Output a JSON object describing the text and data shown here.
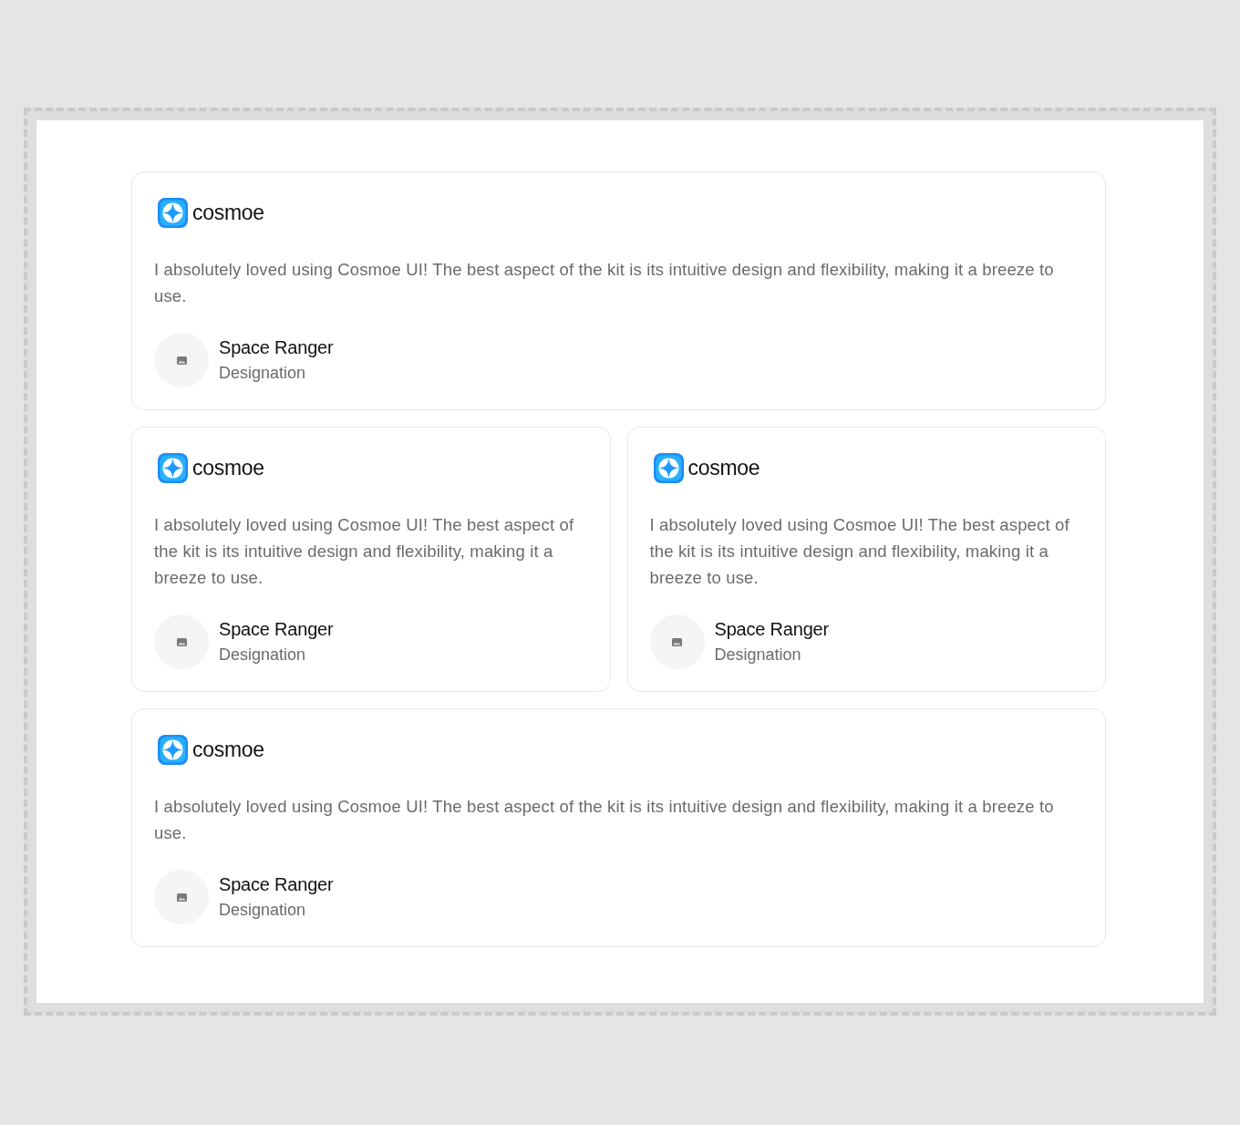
{
  "cards": [
    {
      "kind": "wide",
      "brand": "cosmoe",
      "quote": "I absolutely loved using Cosmoe UI! The best aspect of the kit is its intuitive design and flexibility, making it a breeze to use.",
      "author": {
        "name": "Space Ranger",
        "designation": "Designation"
      }
    },
    {
      "kind": "half",
      "brand": "cosmoe",
      "quote": "I absolutely loved using Cosmoe UI! The best aspect of the kit is its intuitive design and flexibility, making it a breeze to use.",
      "author": {
        "name": "Space Ranger",
        "designation": "Designation"
      }
    },
    {
      "kind": "half",
      "brand": "cosmoe",
      "quote": "I absolutely loved using Cosmoe UI! The best aspect of the kit is its intuitive design and flexibility, making it a breeze to use.",
      "author": {
        "name": "Space Ranger",
        "designation": "Designation"
      }
    },
    {
      "kind": "wide",
      "brand": "cosmoe",
      "quote": "I absolutely loved using Cosmoe UI! The best aspect of the kit is its intuitive design and flexibility, making it a breeze to use.",
      "author": {
        "name": "Space Ranger",
        "designation": "Designation"
      }
    }
  ]
}
